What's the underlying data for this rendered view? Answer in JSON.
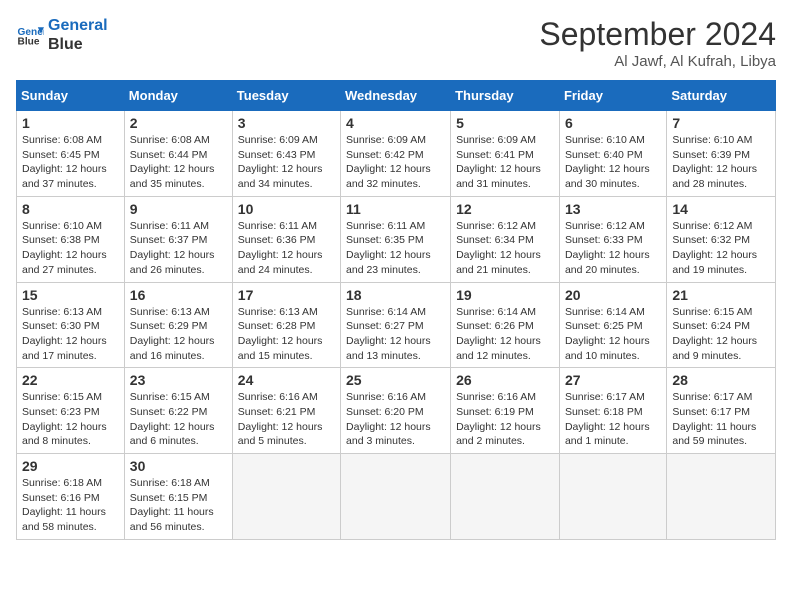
{
  "header": {
    "logo_line1": "General",
    "logo_line2": "Blue",
    "month": "September 2024",
    "location": "Al Jawf, Al Kufrah, Libya"
  },
  "weekdays": [
    "Sunday",
    "Monday",
    "Tuesday",
    "Wednesday",
    "Thursday",
    "Friday",
    "Saturday"
  ],
  "weeks": [
    [
      {
        "day": "1",
        "rise": "6:08 AM",
        "set": "6:45 PM",
        "hours": "12 hours and 37 minutes."
      },
      {
        "day": "2",
        "rise": "6:08 AM",
        "set": "6:44 PM",
        "hours": "12 hours and 35 minutes."
      },
      {
        "day": "3",
        "rise": "6:09 AM",
        "set": "6:43 PM",
        "hours": "12 hours and 34 minutes."
      },
      {
        "day": "4",
        "rise": "6:09 AM",
        "set": "6:42 PM",
        "hours": "12 hours and 32 minutes."
      },
      {
        "day": "5",
        "rise": "6:09 AM",
        "set": "6:41 PM",
        "hours": "12 hours and 31 minutes."
      },
      {
        "day": "6",
        "rise": "6:10 AM",
        "set": "6:40 PM",
        "hours": "12 hours and 30 minutes."
      },
      {
        "day": "7",
        "rise": "6:10 AM",
        "set": "6:39 PM",
        "hours": "12 hours and 28 minutes."
      }
    ],
    [
      {
        "day": "8",
        "rise": "6:10 AM",
        "set": "6:38 PM",
        "hours": "12 hours and 27 minutes."
      },
      {
        "day": "9",
        "rise": "6:11 AM",
        "set": "6:37 PM",
        "hours": "12 hours and 26 minutes."
      },
      {
        "day": "10",
        "rise": "6:11 AM",
        "set": "6:36 PM",
        "hours": "12 hours and 24 minutes."
      },
      {
        "day": "11",
        "rise": "6:11 AM",
        "set": "6:35 PM",
        "hours": "12 hours and 23 minutes."
      },
      {
        "day": "12",
        "rise": "6:12 AM",
        "set": "6:34 PM",
        "hours": "12 hours and 21 minutes."
      },
      {
        "day": "13",
        "rise": "6:12 AM",
        "set": "6:33 PM",
        "hours": "12 hours and 20 minutes."
      },
      {
        "day": "14",
        "rise": "6:12 AM",
        "set": "6:32 PM",
        "hours": "12 hours and 19 minutes."
      }
    ],
    [
      {
        "day": "15",
        "rise": "6:13 AM",
        "set": "6:30 PM",
        "hours": "12 hours and 17 minutes."
      },
      {
        "day": "16",
        "rise": "6:13 AM",
        "set": "6:29 PM",
        "hours": "12 hours and 16 minutes."
      },
      {
        "day": "17",
        "rise": "6:13 AM",
        "set": "6:28 PM",
        "hours": "12 hours and 15 minutes."
      },
      {
        "day": "18",
        "rise": "6:14 AM",
        "set": "6:27 PM",
        "hours": "12 hours and 13 minutes."
      },
      {
        "day": "19",
        "rise": "6:14 AM",
        "set": "6:26 PM",
        "hours": "12 hours and 12 minutes."
      },
      {
        "day": "20",
        "rise": "6:14 AM",
        "set": "6:25 PM",
        "hours": "12 hours and 10 minutes."
      },
      {
        "day": "21",
        "rise": "6:15 AM",
        "set": "6:24 PM",
        "hours": "12 hours and 9 minutes."
      }
    ],
    [
      {
        "day": "22",
        "rise": "6:15 AM",
        "set": "6:23 PM",
        "hours": "12 hours and 8 minutes."
      },
      {
        "day": "23",
        "rise": "6:15 AM",
        "set": "6:22 PM",
        "hours": "12 hours and 6 minutes."
      },
      {
        "day": "24",
        "rise": "6:16 AM",
        "set": "6:21 PM",
        "hours": "12 hours and 5 minutes."
      },
      {
        "day": "25",
        "rise": "6:16 AM",
        "set": "6:20 PM",
        "hours": "12 hours and 3 minutes."
      },
      {
        "day": "26",
        "rise": "6:16 AM",
        "set": "6:19 PM",
        "hours": "12 hours and 2 minutes."
      },
      {
        "day": "27",
        "rise": "6:17 AM",
        "set": "6:18 PM",
        "hours": "12 hours and 1 minute."
      },
      {
        "day": "28",
        "rise": "6:17 AM",
        "set": "6:17 PM",
        "hours": "11 hours and 59 minutes."
      }
    ],
    [
      {
        "day": "29",
        "rise": "6:18 AM",
        "set": "6:16 PM",
        "hours": "11 hours and 58 minutes."
      },
      {
        "day": "30",
        "rise": "6:18 AM",
        "set": "6:15 PM",
        "hours": "11 hours and 56 minutes."
      },
      null,
      null,
      null,
      null,
      null
    ]
  ],
  "labels": {
    "sunrise": "Sunrise:",
    "sunset": "Sunset:",
    "daylight": "Daylight:"
  }
}
